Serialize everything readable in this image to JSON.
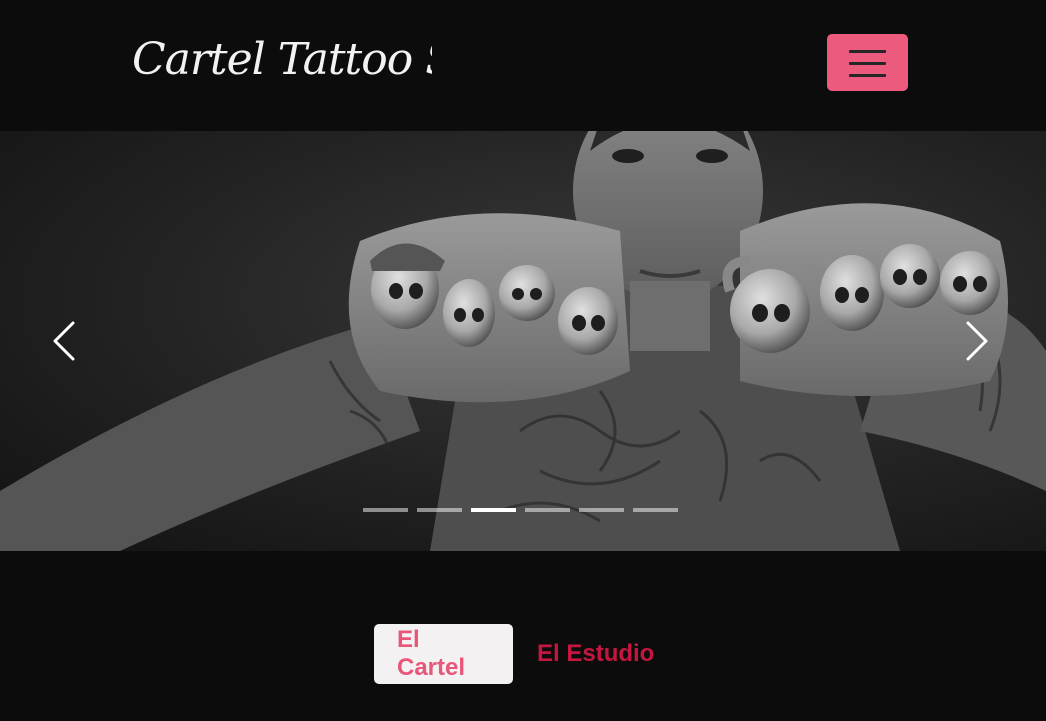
{
  "header": {
    "logo_text": "Cartel Tattoo Studio",
    "menu_icon": "hamburger-icon",
    "menu_color": "#ec5a7e"
  },
  "carousel": {
    "prev_icon": "chevron-left-icon",
    "next_icon": "chevron-right-icon",
    "slide_count": 6,
    "active_index": 2,
    "slide_image": "tattooed-man-with-skull-rings"
  },
  "tabs": [
    {
      "label": "El Cartel",
      "active": true
    },
    {
      "label": "El Estudio",
      "active": false
    }
  ],
  "colors": {
    "background": "#0c0c0d",
    "accent": "#ec5a7e",
    "tab_inactive": "#c4163f"
  }
}
